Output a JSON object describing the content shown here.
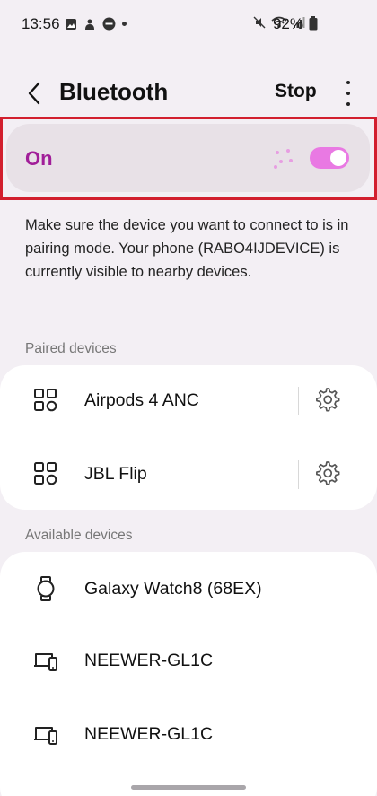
{
  "status_bar": {
    "time": "13:56",
    "battery": "92%",
    "left_icons": [
      "image-icon",
      "puzzle-icon",
      "app-icon",
      "dot-icon"
    ],
    "right_icons": [
      "mute-icon",
      "wifi-icon",
      "signal-icon",
      "battery-icon"
    ]
  },
  "header": {
    "title": "Bluetooth",
    "stop_label": "Stop"
  },
  "toggle": {
    "label": "On",
    "state": true,
    "accent_color": "#a11e99",
    "switch_color": "#e979e3"
  },
  "description": "Make sure the device you want to connect to is in pairing mode. Your phone (RABO4IJDEVICE) is currently visible to nearby devices.",
  "paired": {
    "section_label": "Paired devices",
    "devices": [
      {
        "name": "Airpods 4 ANC",
        "icon": "devices-grid-icon"
      },
      {
        "name": "JBL Flip",
        "icon": "devices-grid-icon"
      }
    ]
  },
  "available": {
    "section_label": "Available devices",
    "devices": [
      {
        "name": "Galaxy Watch8 (68EX)",
        "icon": "watch-icon"
      },
      {
        "name": "NEEWER-GL1C",
        "icon": "phone-monitor-icon"
      },
      {
        "name": "NEEWER-GL1C",
        "icon": "phone-monitor-icon"
      }
    ]
  }
}
